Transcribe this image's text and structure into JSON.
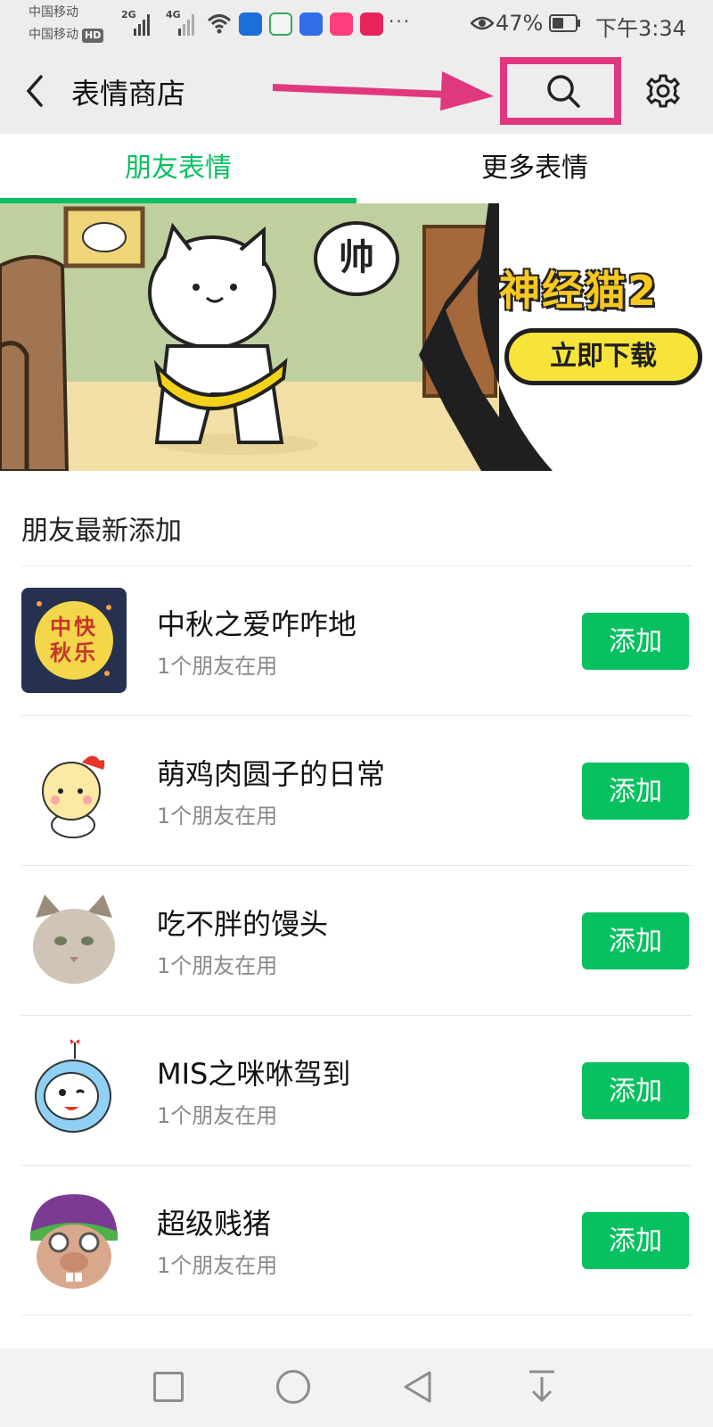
{
  "status_bar": {
    "carrier_1": "中国移动",
    "carrier_2": "中国移动",
    "hd_badge": "HD",
    "net_1": "2G",
    "net_2": "4G",
    "battery": "47%",
    "battery_level": 0.47,
    "time": "下午3:34"
  },
  "header": {
    "title": "表情商店"
  },
  "tabs": [
    {
      "label": "朋友表情",
      "active": true
    },
    {
      "label": "更多表情",
      "active": false
    }
  ],
  "banner": {
    "speech": "帅",
    "title": "神经猫2",
    "cta": "立即下载"
  },
  "section": {
    "title": "朋友最新添加"
  },
  "items": [
    {
      "name": "中秋之爱咋咋地",
      "subtitle": "1个朋友在用",
      "button": "添加",
      "thumb_text": "中快秋乐"
    },
    {
      "name": "萌鸡肉圆子的日常",
      "subtitle": "1个朋友在用",
      "button": "添加"
    },
    {
      "name": "吃不胖的馒头",
      "subtitle": "1个朋友在用",
      "button": "添加"
    },
    {
      "name": "MIS之咪咻驾到",
      "subtitle": "1个朋友在用",
      "button": "添加"
    },
    {
      "name": "超级贱猪",
      "subtitle": "1个朋友在用",
      "button": "添加"
    }
  ],
  "colors": {
    "accent": "#07c160",
    "highlight": "#e0387f"
  }
}
